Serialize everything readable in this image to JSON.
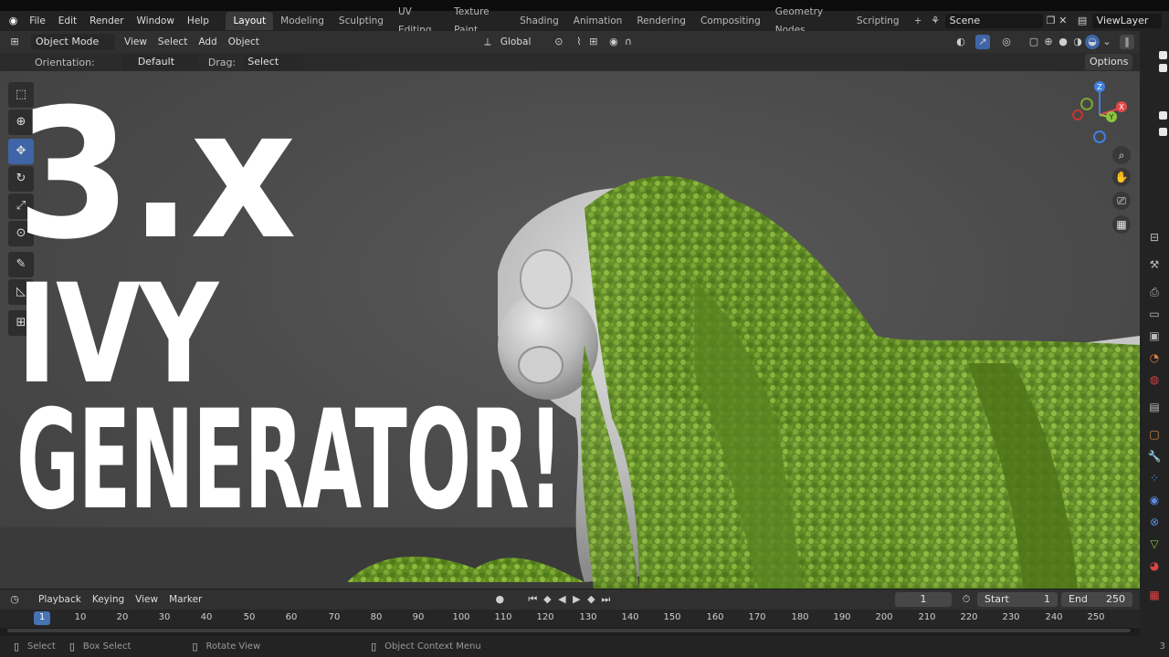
{
  "menubar": {
    "items": [
      "File",
      "Edit",
      "Render",
      "Window",
      "Help"
    ],
    "workspaces": [
      "Layout",
      "Modeling",
      "Sculpting",
      "UV Editing",
      "Texture Paint",
      "Shading",
      "Animation",
      "Rendering",
      "Compositing",
      "Geometry Nodes",
      "Scripting"
    ],
    "active_workspace": "Layout",
    "add_tab": "+",
    "scene": "Scene",
    "view_layer": "ViewLayer"
  },
  "header": {
    "mode": "Object Mode",
    "menus": [
      "View",
      "Select",
      "Add",
      "Object"
    ],
    "transform_orientation": "Global",
    "options_label": "Options"
  },
  "toolsettings": {
    "orientation_label": "Orientation:",
    "orientation_value": "Default",
    "drag_label": "Drag:",
    "drag_value": "Select Box"
  },
  "gizmo": {
    "x": "X",
    "y": "Y",
    "z": "Z"
  },
  "overlay_title": {
    "line1": "3.x",
    "line2": "IVY",
    "line3": "GENERATOR!"
  },
  "timeline": {
    "menus": [
      "Playback",
      "Keying",
      "View",
      "Marker"
    ],
    "current_frame": "1",
    "start_label": "Start",
    "start_value": "1",
    "end_label": "End",
    "end_value": "250",
    "ruler": [
      "1",
      "10",
      "20",
      "30",
      "40",
      "50",
      "60",
      "70",
      "80",
      "90",
      "100",
      "110",
      "120",
      "130",
      "140",
      "150",
      "160",
      "170",
      "180",
      "190",
      "200",
      "210",
      "220",
      "230",
      "240",
      "250"
    ]
  },
  "statusbar": {
    "select": "Select",
    "box_select": "Box Select",
    "rotate_view": "Rotate View",
    "context_menu": "Object Context Menu",
    "version": "3"
  },
  "colors": {
    "accent_blue": "#3f65a8",
    "ivy_green": "#6e9a2a",
    "axis_x": "#e34a4a",
    "axis_y": "#8cc63f",
    "axis_z": "#3f7fe0"
  }
}
